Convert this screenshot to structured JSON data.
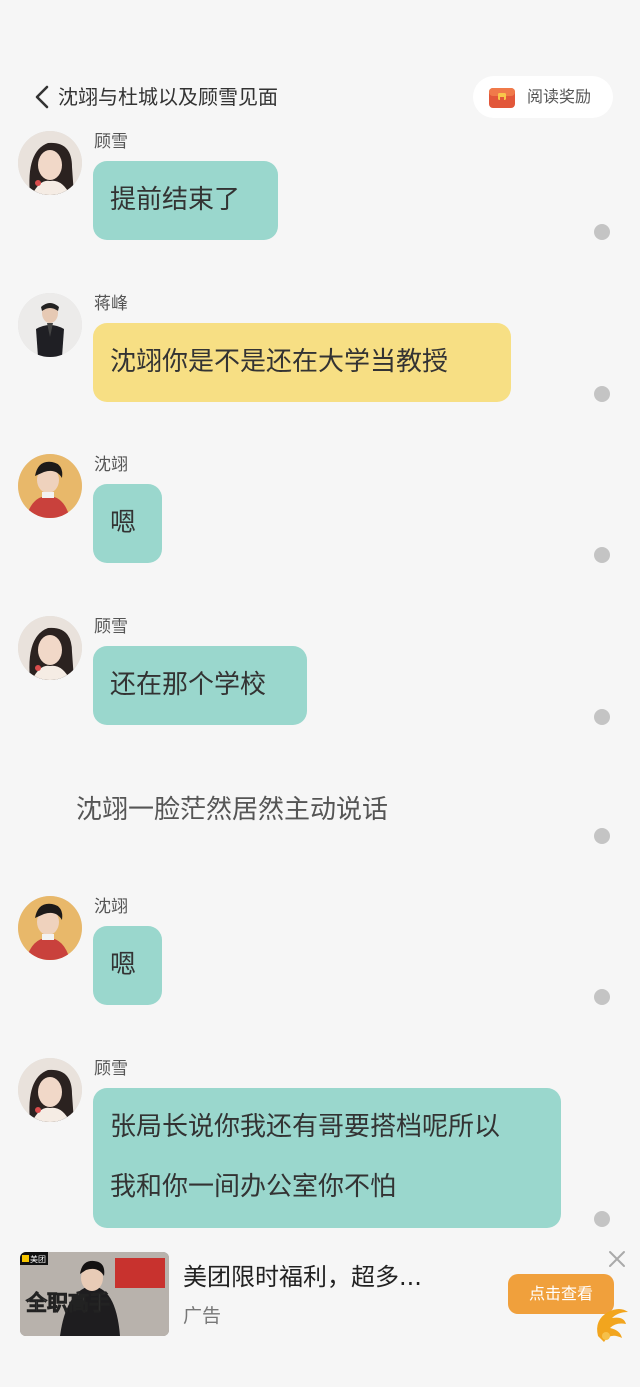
{
  "header": {
    "title": "沈翊与杜城以及顾雪见面",
    "reward_label": "阅读奖励"
  },
  "messages": [
    {
      "name": "顾雪",
      "text": "提前结束了"
    },
    {
      "name": "蒋峰",
      "text": "沈翊你是不是还在大学当教授"
    },
    {
      "name": "沈翊",
      "text": "嗯"
    },
    {
      "name": "顾雪",
      "text": "还在那个学校"
    },
    {
      "narration": "沈翊一脸茫然居然主动说话"
    },
    {
      "name": "沈翊",
      "text": "嗯"
    },
    {
      "name": "顾雪",
      "line1": "张局长说你我还有哥要搭档呢所以",
      "line2": "我和你一间办公室你不怕"
    }
  ],
  "ad": {
    "title": "美团限时福利，超多...",
    "label": "广告",
    "button": "点击查看",
    "image_brand": "美团",
    "image_text": "全职高手"
  },
  "colors": {
    "teal_bubble": "#9ad7cd",
    "yellow_bubble": "#f7df84",
    "ad_button": "#f0a03c",
    "background": "#f6f6f6"
  },
  "icons": [
    "back-arrow-icon",
    "gift-box-icon",
    "more-dot-icon",
    "close-icon",
    "app-logo-icon"
  ]
}
